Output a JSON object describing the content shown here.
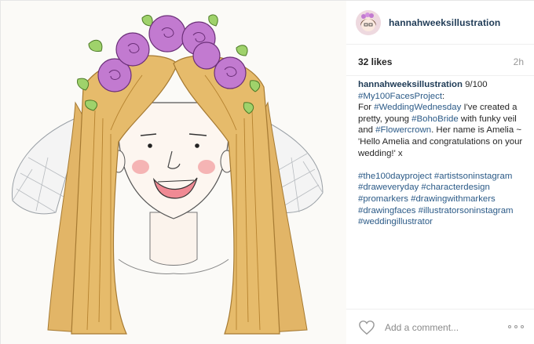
{
  "post": {
    "username": "hannahweeksillustration",
    "likes": "32 likes",
    "time": "2h",
    "caption": {
      "username": "hannahweeksillustration",
      "line1_text": " 9/100",
      "tag_project": "#My100FacesProject",
      "project_colon": ":",
      "for_text": "For ",
      "tag_wedding_wednesday": "#WeddingWednesday",
      "created_text": " I've created a pretty, young ",
      "tag_boho_bride": "#BohoBride",
      "veil_text": " with funky veil and ",
      "tag_flowercrown": "#Flowercrown",
      "name_text": ". Her name is Amelia ~ 'Hello Amelia and congratulations on your wedding!' x",
      "hashtags": [
        "#the100dayproject",
        "#artistsoninstagram",
        "#draweveryday",
        "#characterdesign",
        "#promarkers",
        "#drawingwithmarkers",
        "#drawingfaces",
        "#illustratorsoninstagram",
        "#weddingillustrator"
      ]
    },
    "comment_placeholder": "Add a comment...",
    "colors": {
      "username": "#1f3b56",
      "hashtag": "#2b5a87",
      "flower": "#c27ad0",
      "hair": "#e2b567"
    },
    "icons": {
      "like": "heart-icon",
      "more": "more-options-icon"
    }
  }
}
